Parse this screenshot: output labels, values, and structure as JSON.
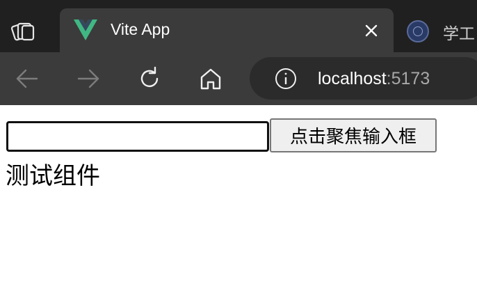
{
  "browser": {
    "workspaces_icon": "workspaces-icon",
    "tabs": [
      {
        "title": "Vite App",
        "favicon": "vue-logo-icon",
        "active": true,
        "close_icon": "close-icon"
      },
      {
        "title": "学工",
        "favicon": "university-seal-icon",
        "active": false
      }
    ],
    "toolbar": {
      "back_icon": "arrow-left-icon",
      "forward_icon": "arrow-right-icon",
      "refresh_icon": "refresh-icon",
      "home_icon": "home-icon",
      "address": {
        "info_icon": "info-icon",
        "host": "localhost",
        "port": ":5173"
      }
    },
    "colors": {
      "tabstrip_bg": "#202020",
      "toolbar_bg": "#3b3b3b",
      "address_bg": "#2b2b2b",
      "vue_green": "#41b883",
      "vue_dark": "#35495e"
    }
  },
  "page": {
    "input": {
      "value": "",
      "placeholder": ""
    },
    "focus_button_label": "点击聚焦输入框",
    "test_component_text": "测试组件"
  }
}
